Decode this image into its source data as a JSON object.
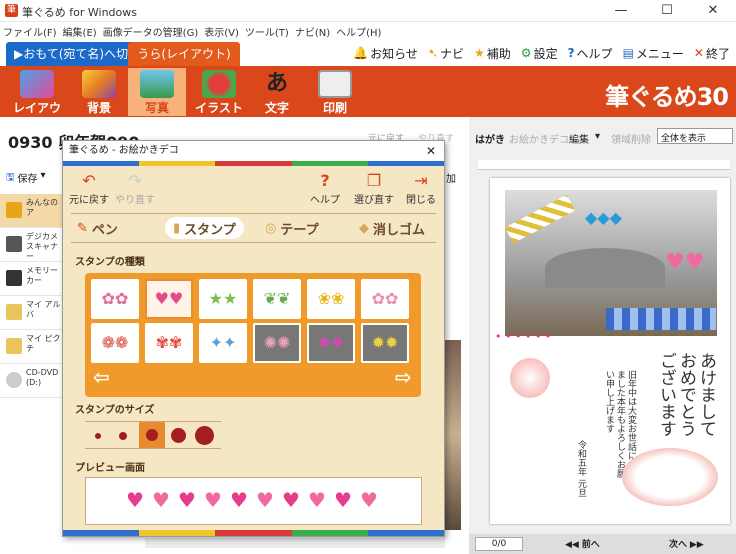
{
  "window": {
    "title": "筆ぐるめ for Windows",
    "min": "—",
    "max": "☐",
    "close": "✕",
    "app_icon": "筆"
  },
  "menu": [
    "ファイル(F)",
    "編集(E)",
    "画像データの管理(G)",
    "表示(V)",
    "ツール(T)",
    "ナビ(N)",
    "ヘルプ(H)"
  ],
  "mode_tabs": {
    "front": "▶おもて(宛て名)へ切替",
    "back": "うら(レイアウト)"
  },
  "top_links": {
    "notice": "お知らせ",
    "navi": "ナビ",
    "assist": "補助",
    "settings": "設定",
    "help": "ヘルプ",
    "menu": "メニュー",
    "exit": "終了"
  },
  "ribbon": {
    "items": [
      {
        "label": "レイアウト"
      },
      {
        "label": "背景"
      },
      {
        "label": "写真"
      },
      {
        "label": "イラスト"
      },
      {
        "label": "文字",
        "glyph": "あ"
      },
      {
        "label": "印刷"
      }
    ],
    "brand": "筆ぐるめ30"
  },
  "left": {
    "doc_title": "0930 卯年賀090",
    "undo": "元に戻す",
    "redo": "やり直す",
    "save": "保存",
    "add": "加",
    "side": [
      "みんなのア",
      "デジカメ\nスキャナー",
      "メモリーカー",
      "マイ アルバ",
      "マイ ピクチ",
      "CD-DVD\n(D:)"
    ]
  },
  "right": {
    "card_type": "はがき",
    "deco": "お絵かきデコ",
    "edit": "編集",
    "delete_area": "領域削除",
    "view_select": "全体を表示",
    "page": "0/0",
    "prev": "前へ",
    "next": "次へ",
    "greeting": "あけましておめでとうございます",
    "message": "旧年中は大変お世話になりました本年もよろしくお願い申し上げます",
    "date": "令和五年 元旦"
  },
  "dialog": {
    "title": "筆ぐるめ - お絵かきデコ",
    "close": "✕",
    "undo": "元に戻す",
    "redo": "やり直す",
    "help": "ヘルプ",
    "select_redo": "選び直す",
    "close_btn": "閉じる",
    "tools": [
      "ペン",
      "スタンプ",
      "テープ",
      "消しゴム"
    ],
    "stamp_kind_label": "スタンプの種類",
    "stamp_size_label": "スタンプのサイズ",
    "preview_label": "プレビュー画面",
    "stamps": [
      {
        "icon": "flower-icon",
        "dark": false,
        "glyph": "✿",
        "color": "#e66c9a"
      },
      {
        "icon": "heart-icon",
        "dark": false,
        "glyph": "♥",
        "color": "#e64c8a",
        "selected": true
      },
      {
        "icon": "star-icon",
        "dark": false,
        "glyph": "★",
        "color": "#7bbf4a"
      },
      {
        "icon": "leaf-icon",
        "dark": false,
        "glyph": "❦",
        "color": "#6aa84f"
      },
      {
        "icon": "ginkgo-icon",
        "dark": false,
        "glyph": "❀",
        "color": "#e5b81e"
      },
      {
        "icon": "sakura-icon",
        "dark": false,
        "glyph": "✿",
        "color": "#f08cb0"
      },
      {
        "icon": "plum-icon",
        "dark": false,
        "glyph": "❁",
        "color": "#d84a3a"
      },
      {
        "icon": "camellia-icon",
        "dark": false,
        "glyph": "✾",
        "color": "#e4483a"
      },
      {
        "icon": "sparkle-star-icon",
        "dark": false,
        "glyph": "✦",
        "color": "#5aa0d8"
      },
      {
        "icon": "firework-icon",
        "dark": true,
        "glyph": "✺",
        "color": "#f0a0c0"
      },
      {
        "icon": "ribbon-icon",
        "dark": true,
        "glyph": "✸",
        "color": "#d04ab0"
      },
      {
        "icon": "burst-icon",
        "dark": true,
        "glyph": "✹",
        "color": "#f0d040"
      }
    ],
    "preview_hearts": 10
  },
  "colors": {
    "ribbon": "#d9471b",
    "tab_blue": "#1b6ac9",
    "tab_orange": "#e25a1c",
    "dialog_bg": "#f5e6c4",
    "grid": "#ef9a2a"
  }
}
